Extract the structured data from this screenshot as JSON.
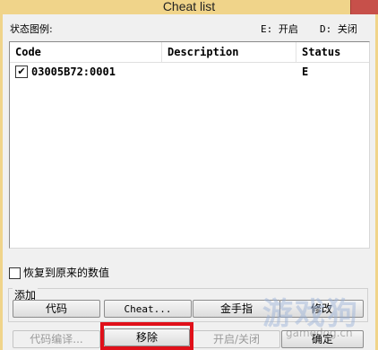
{
  "window": {
    "title": "Cheat list"
  },
  "legend": {
    "label": "状态图例:",
    "enabled": "E: 开启",
    "disabled": "D: 关闭"
  },
  "table": {
    "columns": [
      "Code",
      "Description",
      "Status"
    ],
    "rows": [
      {
        "checked": true,
        "code": "03005B72:0001",
        "description": "",
        "status": "E"
      }
    ]
  },
  "restore_checkbox": {
    "label": "恢复到原来的数值",
    "checked": false
  },
  "add_group": {
    "label": "添加",
    "buttons": {
      "code": "代码",
      "cheat": "Cheat...",
      "gold_finger": "金手指",
      "modify": "修改"
    }
  },
  "bottom_buttons": {
    "compile": "代码编译...",
    "remove": "移除",
    "toggle": "开启/关闭",
    "ok": "确定"
  },
  "watermark": {
    "text": "游戏狗",
    "url": "gamedog.cn"
  },
  "colors": {
    "highlight": "#e0101a",
    "titlebar": "#f0d48a",
    "close": "#c7504a"
  },
  "icons": {
    "row_checkbox": "checkbox-checked-icon",
    "close": "close-icon"
  }
}
